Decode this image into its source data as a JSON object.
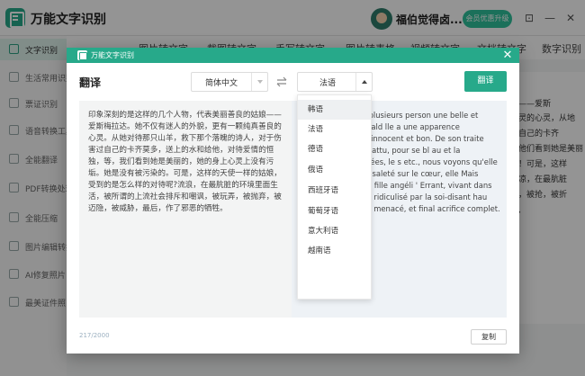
{
  "app": {
    "title": "万能文字识别",
    "user_name": "福伯觉得卤...",
    "vip_label": "会员优惠升级"
  },
  "sidebar": {
    "items": [
      {
        "label": "文字识别"
      },
      {
        "label": "生活常用识别"
      },
      {
        "label": "票证识别"
      },
      {
        "label": "语音转换工具"
      },
      {
        "label": "全能翻译"
      },
      {
        "label": "PDF转换处理"
      },
      {
        "label": "全能压缩"
      },
      {
        "label": "图片编辑转换"
      },
      {
        "label": "AI修复照片"
      },
      {
        "label": "最美证件照"
      }
    ]
  },
  "tabs": {
    "items": [
      {
        "label": "图片转文字"
      },
      {
        "label": "截图转文字"
      },
      {
        "label": "手写转文字"
      },
      {
        "label": "图片转表格"
      },
      {
        "label": "视频转文字"
      },
      {
        "label": "文档转文字"
      },
      {
        "label": "数字识别"
      }
    ]
  },
  "right_panel": {
    "lines": [
      "娘——爱斯",
      "上灵的心灵，从地",
      "过自己的卡齐",
      "乎他们看到她是美丽",
      "纯！可是，这样",
      "的凉，在最肮脏",
      "家，被抢，被折",
      "我,"
    ]
  },
  "dialog": {
    "title": "万能文字识别",
    "heading": "翻译",
    "source_lang": "简体中文",
    "target_lang": "法语",
    "translate_label": "翻译",
    "source_text": "印象深刻的是这样的几个人物，代表美丽善良的姑娘——爱斯梅拉达。她不仅有迷人的外貌，更有一颗纯真善良的心灵。从她对待那只山羊，救下那个落魄的诗人，对于伤害过自己的卡齐莫多，送上的水和给他，对待爱情的恒独，等，我们看到她是美丽的，她的身上心灵上没有污垢。她是没有被污染的。可是，这样的天使一样的姑娘，受到的是怎么样的对待呢?流浪，在最肮脏的环境里面生活，被所谓的上流社会排斥和嘲讽，被玩弄，被抛弃，被迈隐，被威胁，最后，作了邪恶的牺牲。",
    "target_text": "onnant, c'est que plusieurs person une belle et gentille fille-Esmerald lle a une apparence charmante, m eur innocent et bon. De son traite auvant le poète abattu, pour se bl au et la miséricorde envoyées, le s etc., nous voyons qu'elle est belle, a pas de saleté sur le cœur, elle Mais comment une telle fille angéli ' Errant, vivant dans l'environneme é et ridiculisé par la soi-disant hau andonné, encadré, menacé, et final acrifice complet.",
    "char_count": "217/2000",
    "copy_label": "复制",
    "lang_options": [
      "韩语",
      "法语",
      "德语",
      "俄语",
      "西班牙语",
      "葡萄牙语",
      "意大利语",
      "越南语"
    ],
    "hover_index": 0
  },
  "colors": {
    "accent": "#27a98a",
    "vip": "#2fc29b"
  }
}
